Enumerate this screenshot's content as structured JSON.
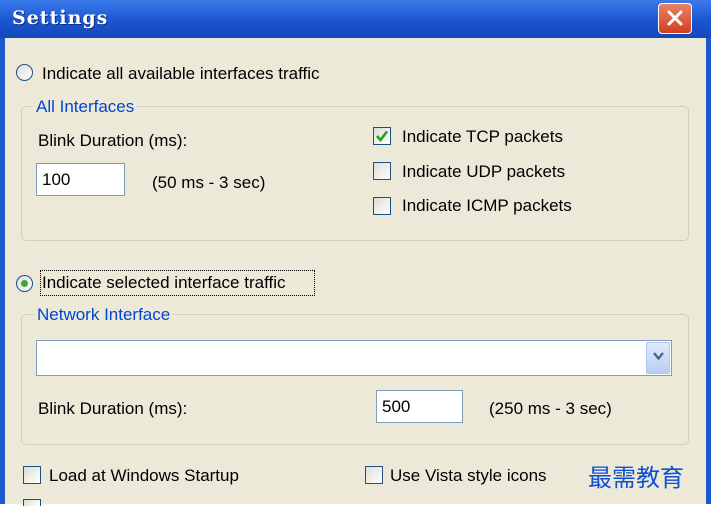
{
  "window": {
    "title": "Settings"
  },
  "traffic_all": {
    "label": "Indicate all available interfaces traffic",
    "selected": false
  },
  "all_interfaces": {
    "legend": "All Interfaces",
    "blink_label": "Blink Duration (ms):",
    "blink_value": "100",
    "range_hint": "(50 ms - 3 sec)",
    "tcp": {
      "label": "Indicate TCP packets",
      "checked": true
    },
    "udp": {
      "label": "Indicate UDP packets",
      "checked": false
    },
    "icmp": {
      "label": "Indicate ICMP packets",
      "checked": false
    }
  },
  "traffic_selected": {
    "label": "Indicate selected interface traffic",
    "selected": true
  },
  "network_interface": {
    "legend": "Network Interface",
    "dropdown_value": "",
    "blink_label": "Blink Duration (ms):",
    "blink_value": "500",
    "range_hint": "(250 ms - 3 sec)"
  },
  "options": {
    "load_startup": {
      "label": "Load at Windows Startup",
      "checked": false
    },
    "vista_icons": {
      "label": "Use Vista style icons",
      "checked": false
    }
  },
  "watermark": "最需教育",
  "colors": {
    "titlebar": "#1a55d2",
    "client_bg": "#ece9d8",
    "legend": "#0046d5",
    "check_green": "#21a121",
    "close_red": "#d0401f"
  }
}
